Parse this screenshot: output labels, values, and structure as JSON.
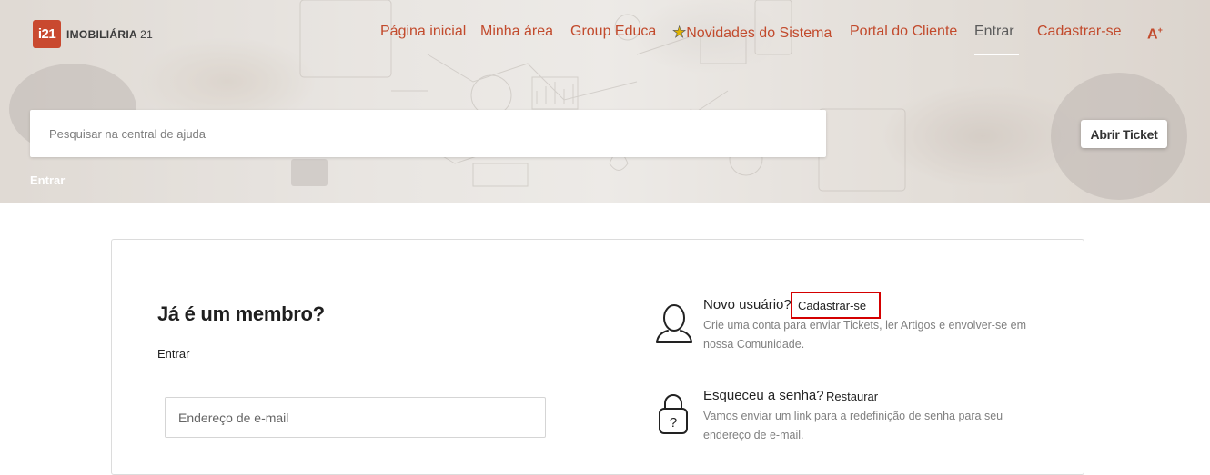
{
  "logo": {
    "mark": "i21",
    "name": "IMOBILIÁRIA",
    "number": "21"
  },
  "nav": {
    "items": [
      {
        "label": "Página inicial"
      },
      {
        "label": "Minha área"
      },
      {
        "label": "Group Educa"
      },
      {
        "label": "Novidades do Sistema",
        "icon": "star-icon"
      },
      {
        "label": "Portal do Cliente"
      },
      {
        "label": "Entrar",
        "active": true
      },
      {
        "label": "Cadastrar-se"
      }
    ],
    "font_toggle": "A",
    "font_toggle_sup": "+"
  },
  "search": {
    "placeholder": "Pesquisar na central de ajuda",
    "value": ""
  },
  "ticket_button": "Abrir Ticket",
  "breadcrumb": "Entrar",
  "login": {
    "title": "Já é um membro?",
    "subtitle": "Entrar",
    "email_placeholder": "Endereço de e-mail"
  },
  "new_user": {
    "title": "Novo usuário?",
    "link": "Cadastrar-se",
    "description": "Crie uma conta para enviar Tickets, ler Artigos e envolver-se em nossa Comunidade."
  },
  "forgot": {
    "title": "Esqueceu a senha?",
    "link": "Restaurar",
    "description": "Vamos enviar um link para a redefinição de senha para seu endereço de e-mail."
  },
  "colors": {
    "accent": "#c24a2c",
    "logo": "#c9492f",
    "highlight": "#d40000"
  }
}
